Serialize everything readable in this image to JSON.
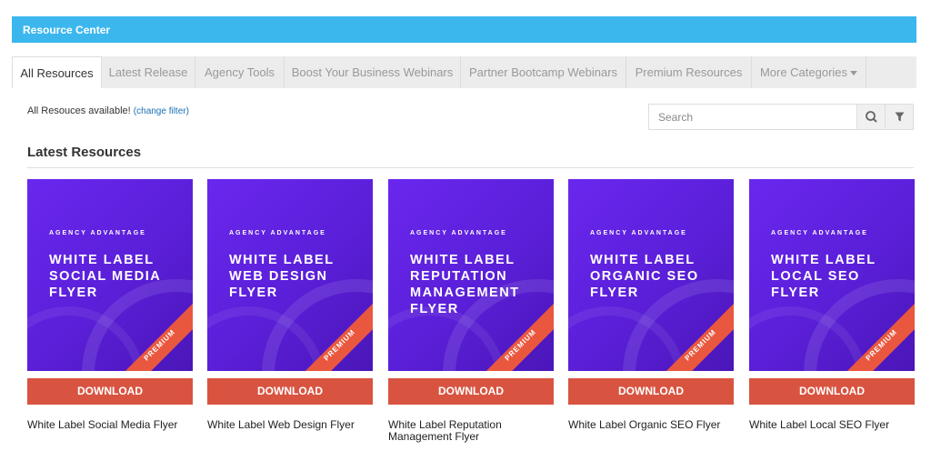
{
  "header": {
    "title": "Resource Center"
  },
  "tabs": [
    {
      "label": "All Resources"
    },
    {
      "label": "Latest Release"
    },
    {
      "label": "Agency Tools"
    },
    {
      "label": "Boost Your Business Webinars"
    },
    {
      "label": "Partner Bootcamp Webinars"
    },
    {
      "label": "Premium Resources"
    },
    {
      "label": "More Categories"
    }
  ],
  "filter": {
    "text": "All Resouces available!",
    "link": "(change filter)"
  },
  "search": {
    "placeholder": "Search"
  },
  "icons": {
    "search": "search-icon",
    "filter": "filter-icon"
  },
  "section": {
    "title": "Latest Resources"
  },
  "brand": "AGENCY ADVANTAGE",
  "badge": "PREMIUM",
  "download_label": "DOWNLOAD",
  "cards": [
    {
      "thumb_title": "WHITE LABEL SOCIAL MEDIA FLYER",
      "caption": "White Label Social Media Flyer"
    },
    {
      "thumb_title": "WHITE LABEL WEB DESIGN FLYER",
      "caption": "White Label Web Design Flyer"
    },
    {
      "thumb_title": "WHITE LABEL REPUTATION MANAGEMENT FLYER",
      "caption": "White Label Reputation Management Flyer"
    },
    {
      "thumb_title": "WHITE LABEL ORGANIC SEO FLYER",
      "caption": "White Label Organic SEO Flyer"
    },
    {
      "thumb_title": "WHITE LABEL LOCAL SEO FLYER",
      "caption": "White Label Local SEO Flyer"
    }
  ],
  "colors": {
    "header": "#3cb7ee",
    "download": "#d85441",
    "thumb": "#6a27ee",
    "ribbon": "#e9573f",
    "link": "#1a6fb4"
  }
}
